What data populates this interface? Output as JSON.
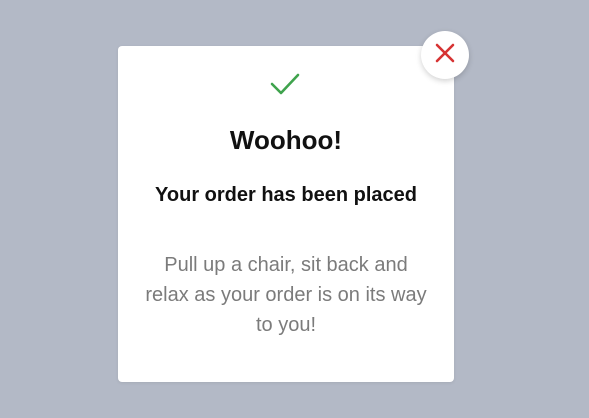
{
  "modal": {
    "title": "Woohoo!",
    "subtitle": "Your order has been placed",
    "message": "Pull up a chair, sit back and relax as your order is on its way to you!"
  },
  "icons": {
    "success": "check-icon",
    "close": "close-icon"
  },
  "colors": {
    "background": "#b3b9c6",
    "success": "#3fa34d",
    "close": "#d63333",
    "message_text": "#7b7b7b"
  }
}
